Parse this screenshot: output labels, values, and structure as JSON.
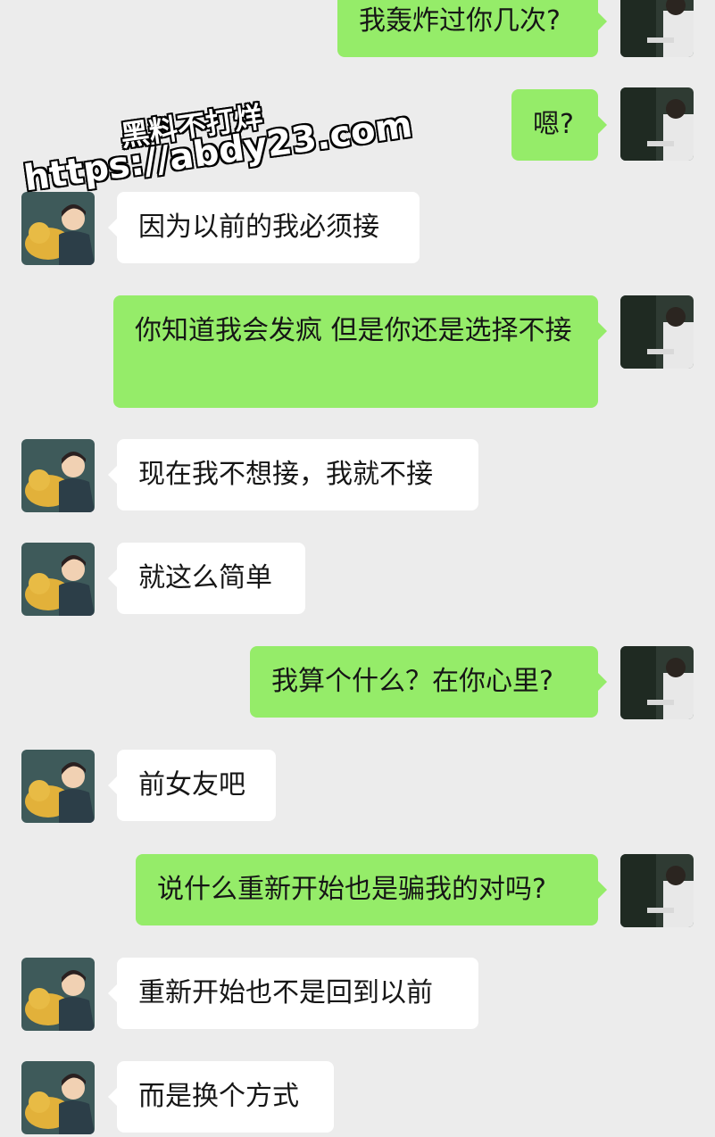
{
  "colors": {
    "background": "#ececec",
    "sent_bubble": "#95ec69",
    "received_bubble": "#ffffff",
    "text": "#161616"
  },
  "watermark": {
    "line1": "黑料不打烊",
    "line2": "https://abdy23.com"
  },
  "messages": [
    {
      "side": "right",
      "text": "我轰炸过你几次?"
    },
    {
      "side": "right",
      "text": "嗯?"
    },
    {
      "side": "left",
      "text": "因为以前的我必须接"
    },
    {
      "side": "right",
      "text": "你知道我会发疯 但是你还是选择不接"
    },
    {
      "side": "left",
      "text": "现在我不想接，我就不接"
    },
    {
      "side": "left",
      "text": "就这么简单"
    },
    {
      "side": "right",
      "text": "我算个什么？在你心里?"
    },
    {
      "side": "left",
      "text": "前女友吧"
    },
    {
      "side": "right",
      "text": "说什么重新开始也是骗我的对吗?"
    },
    {
      "side": "left",
      "text": "重新开始也不是回到以前"
    },
    {
      "side": "left",
      "text": "而是换个方式"
    }
  ],
  "avatars": {
    "left": "boy-with-dog-avatar",
    "right": "girl-photo-avatar"
  }
}
